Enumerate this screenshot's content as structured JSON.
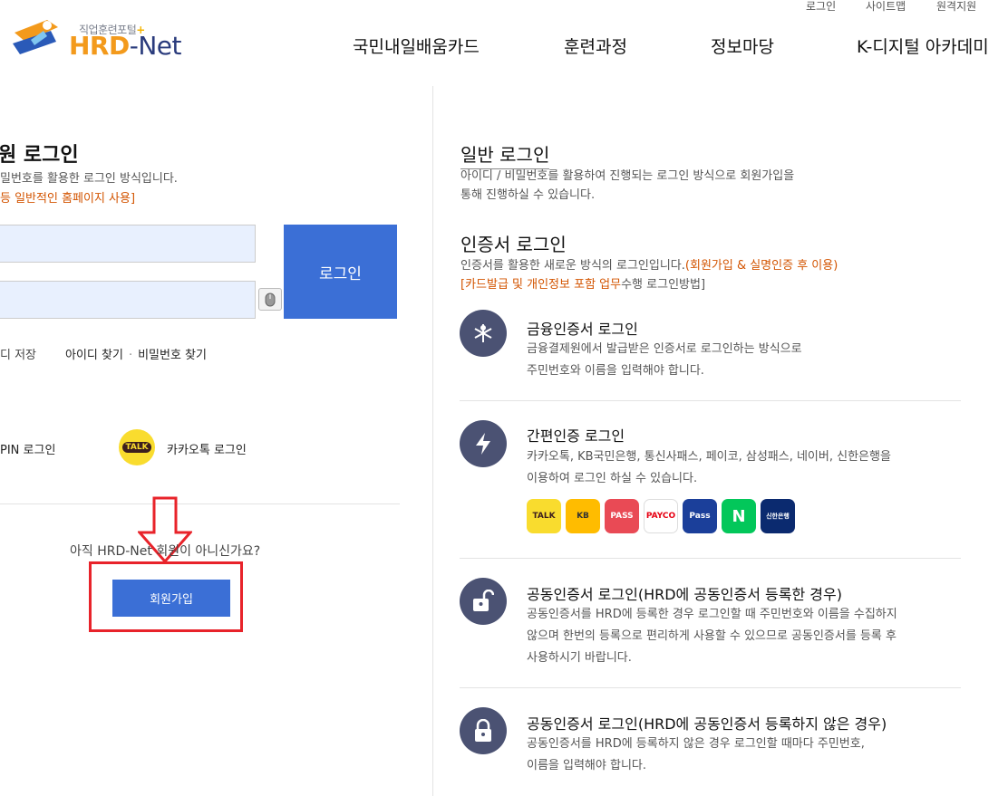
{
  "header": {
    "logo_sub": "직업훈련포털",
    "logo_hrd": "HRD",
    "logo_net": "-Net",
    "util": [
      "로그인",
      "사이트맵",
      "원격지원"
    ],
    "gnb": [
      "국민내일배움카드",
      "훈련과정",
      "정보마당",
      "K-디지털 아카데미"
    ]
  },
  "member_login": {
    "title": "원 로그인",
    "desc": "밀번호를 활용한 로그인 방식입니다.",
    "note": "등 일반적인 홈페이지 사용]",
    "login_button": "로그인",
    "save_id": "디 저장",
    "find_id": "아이디 찾기",
    "find_pw": "비밀번호 찾기",
    "pin_login": "PIN 로그인",
    "kakao_icon_text": "TALK",
    "kakao_login": "카카오톡 로그인",
    "not_member": "아직 HRD-Net 회원이 아니신가요?",
    "join_button": "회원가입"
  },
  "general": {
    "title": "일반 로그인",
    "desc1": "아이디 / 비밀번호를 활용하여 진행되는 로그인 방식으로 회원가입을",
    "desc2": "통해 진행하실 수 있습니다."
  },
  "cert": {
    "title": "인증서 로그인",
    "desc1": "인증서를 활용한 새로운 방식의 로그인입니다.",
    "desc1_orange": "(회원가입 & 실명인증 후 이용)",
    "desc2_orange": "[카드발급 및 개인정보 포함 업무",
    "desc2_rest": "수행 로그인방법]"
  },
  "items": [
    {
      "title": "금융인증서 로그인",
      "desc": [
        "금융결제원에서 발급받은 인증서로 로그인하는 방식으로",
        "주민번호와 이름을 입력해야 합니다."
      ]
    },
    {
      "title": "간편인증 로그인",
      "desc": [
        "카카오톡, KB국민은행, 통신사패스, 페이코, 삼성패스, 네이버, 신한은행을",
        "이용하여 로그인 하실 수 있습니다."
      ]
    },
    {
      "title": "공동인증서 로그인(HRD에 공동인증서 등록한 경우)",
      "desc": [
        "공동인증서를 HRD에 등록한 경우 로그인할 때 주민번호와 이름을 수집하지",
        "않으며 한번의 등록으로 편리하게 사용할 수 있으므로 공동인증서를 등록 후",
        "사용하시기 바랍니다."
      ]
    },
    {
      "title": "공동인증서 로그인(HRD에 공동인증서 등록하지 않은 경우)",
      "desc": [
        "공동인증서를 HRD에 등록하지 않은 경우 로그인할 때마다 주민번호,",
        "이름을 입력해야 합니다."
      ]
    }
  ],
  "apps": [
    {
      "label": "TALK",
      "bg": "#f9dc2e",
      "fg": "#3c1e1e"
    },
    {
      "label": "KB",
      "bg": "#ffbc00",
      "fg": "#333"
    },
    {
      "label": "PASS",
      "bg": "#e94a55",
      "fg": "#fff"
    },
    {
      "label": "PAYCO",
      "bg": "#ffffff",
      "fg": "#e60012"
    },
    {
      "label": "Pass",
      "bg": "#1b3f9a",
      "fg": "#fff"
    },
    {
      "label": "N",
      "bg": "#03c75a",
      "fg": "#fff"
    },
    {
      "label": "신한은행",
      "bg": "#0b2a6f",
      "fg": "#fff"
    }
  ],
  "colors": {
    "primary": "#3b6fd6",
    "accent": "#d35400",
    "highlight": "#e8232a",
    "icon_bg": "#4b5273"
  }
}
